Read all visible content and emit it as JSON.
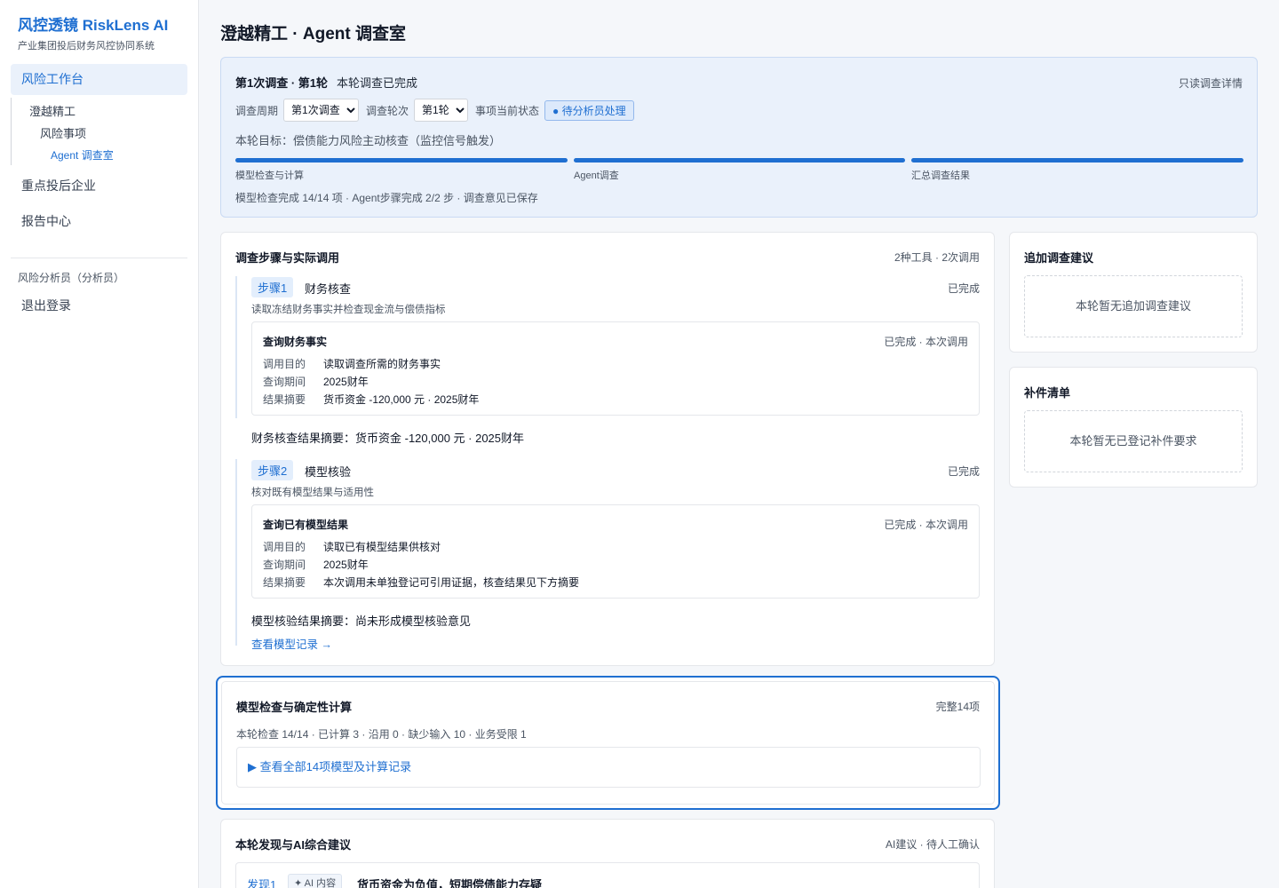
{
  "brand": {
    "title": "风控透镜 RiskLens AI",
    "subtitle": "产业集团投后财务风控协同系统"
  },
  "sidebar": {
    "active": "风险工作台",
    "tree": [
      "澄越精工",
      "风险事项",
      "Agent 调查室"
    ],
    "items": [
      "重点投后企业",
      "报告中心"
    ],
    "role": "风险分析员（分析员）",
    "logout": "退出登录"
  },
  "page": {
    "title": "澄越精工 · Agent 调查室"
  },
  "summary": {
    "round_title": "第1次调查 · 第1轮",
    "round_status": "本轮调查已完成",
    "readonly": "只读调查详情",
    "period_label": "调查周期",
    "period_value": "第1次调查",
    "round_label": "调查轮次",
    "round_value": "第1轮",
    "state_label": "事项当前状态",
    "state_badge": "● 待分析员处理",
    "goal": "本轮目标：偿债能力风险主动核查（监控信号触发）",
    "stages": [
      "模型检查与计算",
      "Agent调查",
      "汇总调查结果"
    ],
    "stage_progress": [
      1,
      1,
      1
    ],
    "footer": "模型检查完成 14/14 项 · Agent步骤完成 2/2 步 · 调查意见已保存"
  },
  "steps_card": {
    "title": "调查步骤与实际调用",
    "meta": "2种工具 · 2次调用",
    "steps": [
      {
        "tag": "步骤1",
        "name": "财务核查",
        "status": "已完成",
        "desc": "读取冻结财务事实并检查现金流与偿债指标",
        "tool_title": "查询财务事实",
        "tool_status": "已完成 · 本次调用",
        "rows": [
          {
            "k": "调用目的",
            "v": "读取调查所需的财务事实"
          },
          {
            "k": "查询期间",
            "v": "2025财年"
          },
          {
            "k": "结果摘要",
            "v": "货币资金 -120,000 元 · 2025财年"
          }
        ],
        "summary": "财务核查结果摘要：货币资金 -120,000 元 · 2025财年"
      },
      {
        "tag": "步骤2",
        "name": "模型核验",
        "status": "已完成",
        "desc": "核对既有模型结果与适用性",
        "tool_title": "查询已有模型结果",
        "tool_status": "已完成 · 本次调用",
        "rows": [
          {
            "k": "调用目的",
            "v": "读取已有模型结果供核对"
          },
          {
            "k": "查询期间",
            "v": "2025财年"
          },
          {
            "k": "结果摘要",
            "v": "本次调用未单独登记可引用证据，核查结果见下方摘要"
          }
        ],
        "summary": "模型核验结果摘要：尚未形成模型核验意见",
        "link": "查看模型记录 →"
      }
    ]
  },
  "suggest_card": {
    "title": "追加调查建议",
    "empty": "本轮暂无追加调查建议"
  },
  "supplement_card": {
    "title": "补件清单",
    "empty": "本轮暂无已登记补件要求"
  },
  "model_card": {
    "title": "模型检查与确定性计算",
    "meta": "完整14项",
    "line": "本轮检查 14/14 · 已计算 3 · 沿用 0 · 缺少输入 10 · 业务受限 1",
    "expander": "▶ 查看全部14项模型及计算记录"
  },
  "findings_card": {
    "title": "本轮发现与AI综合建议",
    "meta": "AI建议 · 待人工确认",
    "first_tag": "发现1",
    "ai_badge": "✦ AI 内容",
    "first_title": "货币资金为负值，短期偿债能力存疑"
  },
  "colors": {
    "accent": "#1f6fd1",
    "summary_bg": "#eaf1fb"
  }
}
